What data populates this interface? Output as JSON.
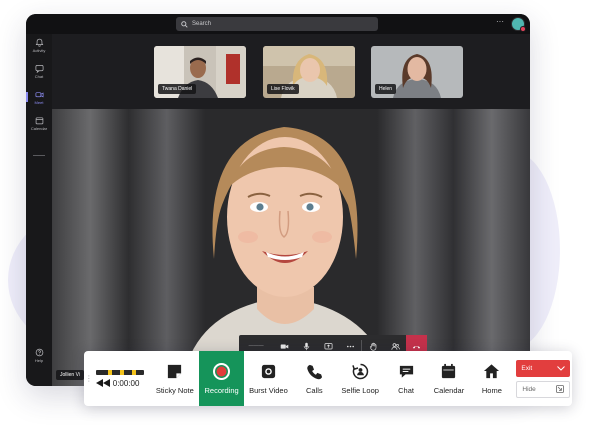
{
  "search": {
    "placeholder": "Search"
  },
  "rail": {
    "items": [
      {
        "label": "Activity",
        "icon": "bell-icon"
      },
      {
        "label": "Chat",
        "icon": "chat-icon"
      },
      {
        "label": "Meet",
        "icon": "camera-icon",
        "active": true
      },
      {
        "label": "Calendar",
        "icon": "calendar-icon"
      }
    ],
    "help": "Help"
  },
  "participants": [
    {
      "name": "Twana Daniel"
    },
    {
      "name": "Lise Flovik"
    },
    {
      "name": "Helen"
    }
  ],
  "speaker": {
    "name": "Jollien Vi"
  },
  "controls": {
    "icons": [
      "camera-icon",
      "microphone-icon",
      "share-screen-icon",
      "more-icon",
      "raise-hand-icon",
      "participants-icon",
      "hang-up-icon"
    ]
  },
  "toolbar": {
    "timecode": "0:00:00",
    "tools": [
      {
        "label": "Sticky Note",
        "icon": "sticky-note-icon"
      },
      {
        "label": "Recording",
        "icon": "record-icon",
        "active": true
      },
      {
        "label": "Burst Video",
        "icon": "burst-video-icon"
      },
      {
        "label": "Calls",
        "icon": "phone-icon"
      },
      {
        "label": "Selfie Loop",
        "icon": "selfie-loop-icon"
      },
      {
        "label": "Chat",
        "icon": "chat-bubble-icon"
      },
      {
        "label": "Calendar",
        "icon": "calendar-icon"
      },
      {
        "label": "Home",
        "icon": "home-icon"
      }
    ],
    "exit_label": "Exit",
    "hide_label": "Hide"
  },
  "colors": {
    "accent_green": "#15945a",
    "exit_red": "#e23e3e",
    "hangup_red": "#c4314b",
    "rail_active": "#8c8cf2"
  }
}
